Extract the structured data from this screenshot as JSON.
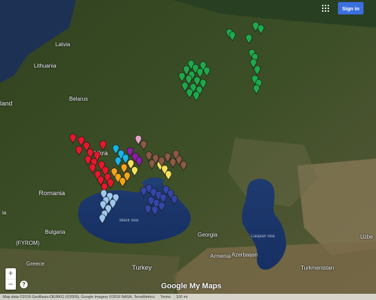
{
  "header": {
    "sign_in": "Sign in",
    "apps_icon": "apps-grid-icon"
  },
  "controls": {
    "zoom_in": "+",
    "zoom_out": "−",
    "help": "?"
  },
  "branding": {
    "logo_google": "Google",
    "logo_mymaps": "My Maps"
  },
  "footer": {
    "attribution": "Map data ©2016 GeoBasis-DE/BKG (©2009), Google Imagery ©2016 NASA, TerraMetrics",
    "terms": "Terms",
    "scale": "100 mi"
  },
  "labels": {
    "latvia": "Latvia",
    "lithuania": "Lithuania",
    "belarus": "Belarus",
    "land": "land",
    "ukraine": "Ukra",
    "romania": "Romania",
    "bulgaria": "Bulgaria",
    "fyrom": "(FYROM)",
    "greece": "Greece",
    "turkey": "Turkey",
    "georgia": "Georgia",
    "azerbaijan": "Azerbaijan",
    "armenia": "Armenia",
    "turkmenistan": "Turkmenistan",
    "uzbe": "Uzbe",
    "serbia": "ia",
    "black_sea": "Black Sea",
    "caspian_sea": "Caspian Sea"
  },
  "colors": {
    "green": "#1fa84a",
    "red": "#e8172c",
    "orange": "#f4a41a",
    "yellow": "#f6e05a",
    "lightblue": "#9cc8f0",
    "navy": "#3346a8",
    "cyan": "#19b5e6",
    "purple": "#8b1ea8",
    "brown": "#8a5a44",
    "pink": "#e6a4c2"
  },
  "markers": [
    {
      "lat": 57.7,
      "lon": 45.0,
      "c": "green"
    },
    {
      "lat": 57.5,
      "lon": 45.4,
      "c": "green"
    },
    {
      "lat": 58.2,
      "lon": 48.5,
      "c": "green"
    },
    {
      "lat": 58.0,
      "lon": 49.2,
      "c": "green"
    },
    {
      "lat": 57.3,
      "lon": 47.6,
      "c": "green"
    },
    {
      "lat": 56.2,
      "lon": 48.0,
      "c": "green"
    },
    {
      "lat": 55.9,
      "lon": 48.4,
      "c": "green"
    },
    {
      "lat": 55.5,
      "lon": 48.2,
      "c": "green"
    },
    {
      "lat": 55.0,
      "lon": 48.7,
      "c": "green"
    },
    {
      "lat": 54.3,
      "lon": 48.4,
      "c": "green"
    },
    {
      "lat": 54.0,
      "lon": 48.9,
      "c": "green"
    },
    {
      "lat": 53.6,
      "lon": 48.6,
      "c": "green"
    },
    {
      "lat": 55.4,
      "lon": 39.9,
      "c": "green"
    },
    {
      "lat": 55.1,
      "lon": 40.5,
      "c": "green"
    },
    {
      "lat": 55.0,
      "lon": 39.3,
      "c": "green"
    },
    {
      "lat": 54.8,
      "lon": 41.1,
      "c": "green"
    },
    {
      "lat": 54.6,
      "lon": 40.0,
      "c": "green"
    },
    {
      "lat": 54.5,
      "lon": 38.7,
      "c": "green"
    },
    {
      "lat": 54.3,
      "lon": 39.6,
      "c": "green"
    },
    {
      "lat": 54.2,
      "lon": 40.7,
      "c": "green"
    },
    {
      "lat": 54.0,
      "lon": 41.5,
      "c": "green"
    },
    {
      "lat": 53.8,
      "lon": 39.1,
      "c": "green"
    },
    {
      "lat": 53.7,
      "lon": 40.2,
      "c": "green"
    },
    {
      "lat": 53.5,
      "lon": 41.0,
      "c": "green"
    },
    {
      "lat": 53.3,
      "lon": 39.7,
      "c": "green"
    },
    {
      "lat": 53.1,
      "lon": 40.6,
      "c": "green"
    },
    {
      "lat": 54.9,
      "lon": 42.0,
      "c": "green"
    },
    {
      "lat": 55.3,
      "lon": 41.5,
      "c": "green"
    },
    {
      "lat": 50.0,
      "lon": 24.2,
      "c": "red"
    },
    {
      "lat": 49.8,
      "lon": 25.3,
      "c": "red"
    },
    {
      "lat": 49.4,
      "lon": 26.0,
      "c": "red"
    },
    {
      "lat": 49.1,
      "lon": 25.0,
      "c": "red"
    },
    {
      "lat": 48.9,
      "lon": 26.5,
      "c": "red"
    },
    {
      "lat": 48.7,
      "lon": 27.4,
      "c": "red"
    },
    {
      "lat": 48.4,
      "lon": 26.2,
      "c": "red"
    },
    {
      "lat": 48.2,
      "lon": 27.0,
      "c": "red"
    },
    {
      "lat": 48.0,
      "lon": 28.0,
      "c": "red"
    },
    {
      "lat": 47.8,
      "lon": 26.8,
      "c": "red"
    },
    {
      "lat": 47.6,
      "lon": 28.5,
      "c": "red"
    },
    {
      "lat": 47.3,
      "lon": 27.5,
      "c": "red"
    },
    {
      "lat": 47.1,
      "lon": 28.8,
      "c": "red"
    },
    {
      "lat": 46.9,
      "lon": 27.9,
      "c": "red"
    },
    {
      "lat": 46.7,
      "lon": 29.2,
      "c": "red"
    },
    {
      "lat": 46.4,
      "lon": 28.4,
      "c": "red"
    },
    {
      "lat": 49.5,
      "lon": 28.2,
      "c": "red"
    },
    {
      "lat": 47.5,
      "lon": 29.7,
      "c": "orange"
    },
    {
      "lat": 47.1,
      "lon": 30.2,
      "c": "orange"
    },
    {
      "lat": 46.8,
      "lon": 30.8,
      "c": "orange"
    },
    {
      "lat": 47.8,
      "lon": 31.0,
      "c": "orange"
    },
    {
      "lat": 47.2,
      "lon": 31.4,
      "c": "orange"
    },
    {
      "lat": 48.1,
      "lon": 31.9,
      "c": "yellow"
    },
    {
      "lat": 47.6,
      "lon": 32.4,
      "c": "yellow"
    },
    {
      "lat": 48.0,
      "lon": 35.8,
      "c": "yellow"
    },
    {
      "lat": 47.7,
      "lon": 36.4,
      "c": "yellow"
    },
    {
      "lat": 47.3,
      "lon": 36.9,
      "c": "yellow"
    },
    {
      "lat": 49.2,
      "lon": 29.9,
      "c": "cyan"
    },
    {
      "lat": 48.8,
      "lon": 30.6,
      "c": "cyan"
    },
    {
      "lat": 48.5,
      "lon": 31.2,
      "c": "cyan"
    },
    {
      "lat": 48.3,
      "lon": 30.2,
      "c": "cyan"
    },
    {
      "lat": 49.0,
      "lon": 31.8,
      "c": "purple"
    },
    {
      "lat": 48.6,
      "lon": 32.5,
      "c": "purple"
    },
    {
      "lat": 48.3,
      "lon": 33.0,
      "c": "purple"
    },
    {
      "lat": 49.9,
      "lon": 32.9,
      "c": "pink"
    },
    {
      "lat": 48.7,
      "lon": 34.3,
      "c": "brown"
    },
    {
      "lat": 48.5,
      "lon": 35.2,
      "c": "brown"
    },
    {
      "lat": 48.3,
      "lon": 36.0,
      "c": "brown"
    },
    {
      "lat": 48.6,
      "lon": 36.8,
      "c": "brown"
    },
    {
      "lat": 48.2,
      "lon": 37.5,
      "c": "brown"
    },
    {
      "lat": 48.4,
      "lon": 38.3,
      "c": "brown"
    },
    {
      "lat": 48.0,
      "lon": 38.9,
      "c": "brown"
    },
    {
      "lat": 48.8,
      "lon": 37.9,
      "c": "brown"
    },
    {
      "lat": 48.1,
      "lon": 34.7,
      "c": "brown"
    },
    {
      "lat": 49.5,
      "lon": 33.6,
      "c": "brown"
    },
    {
      "lat": 46.3,
      "lon": 34.3,
      "c": "navy"
    },
    {
      "lat": 46.0,
      "lon": 34.9,
      "c": "navy"
    },
    {
      "lat": 45.8,
      "lon": 35.6,
      "c": "navy"
    },
    {
      "lat": 45.6,
      "lon": 36.2,
      "c": "navy"
    },
    {
      "lat": 45.4,
      "lon": 34.6,
      "c": "navy"
    },
    {
      "lat": 45.2,
      "lon": 35.3,
      "c": "navy"
    },
    {
      "lat": 45.0,
      "lon": 36.0,
      "c": "navy"
    },
    {
      "lat": 44.8,
      "lon": 34.2,
      "c": "navy"
    },
    {
      "lat": 44.7,
      "lon": 35.1,
      "c": "navy"
    },
    {
      "lat": 46.2,
      "lon": 36.6,
      "c": "navy"
    },
    {
      "lat": 45.9,
      "lon": 37.2,
      "c": "navy"
    },
    {
      "lat": 45.5,
      "lon": 37.7,
      "c": "navy"
    },
    {
      "lat": 46.1,
      "lon": 33.6,
      "c": "navy"
    },
    {
      "lat": 45.9,
      "lon": 28.3,
      "c": "lightblue"
    },
    {
      "lat": 45.7,
      "lon": 29.1,
      "c": "lightblue"
    },
    {
      "lat": 45.4,
      "lon": 28.6,
      "c": "lightblue"
    },
    {
      "lat": 45.1,
      "lon": 28.2,
      "c": "lightblue"
    },
    {
      "lat": 44.8,
      "lon": 28.9,
      "c": "lightblue"
    },
    {
      "lat": 44.4,
      "lon": 28.4,
      "c": "lightblue"
    },
    {
      "lat": 44.1,
      "lon": 28.1,
      "c": "lightblue"
    },
    {
      "lat": 45.6,
      "lon": 29.9,
      "c": "lightblue"
    },
    {
      "lat": 45.2,
      "lon": 29.5,
      "c": "lightblue"
    }
  ]
}
